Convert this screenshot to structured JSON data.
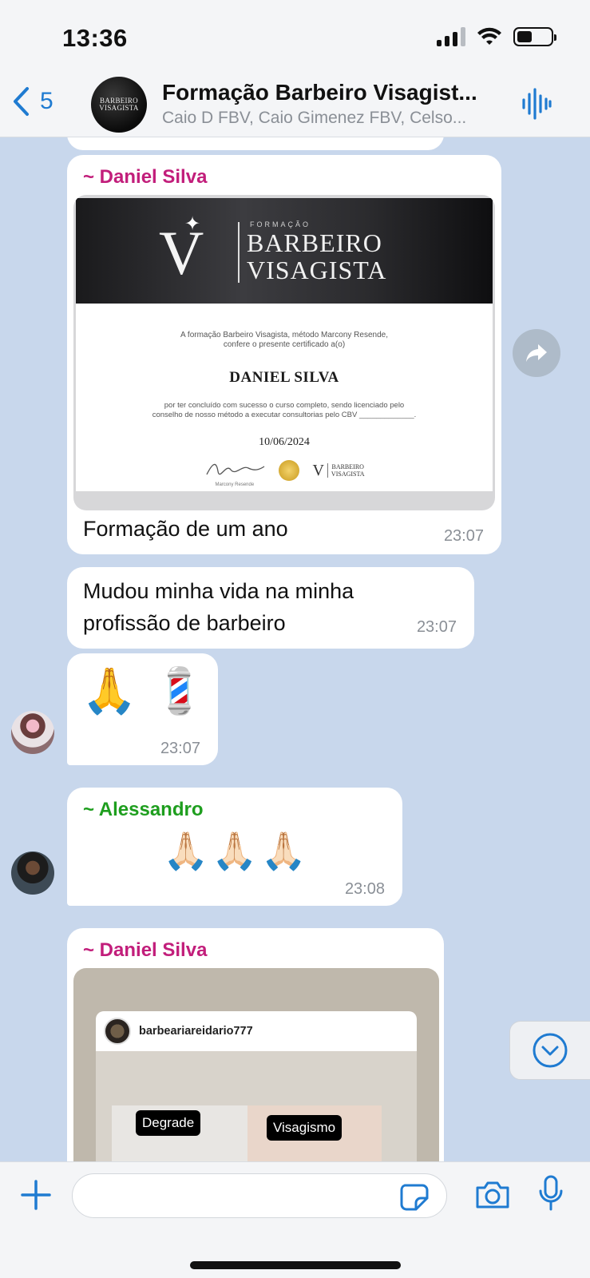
{
  "status_bar": {
    "time": "13:36"
  },
  "header": {
    "back_count": "5",
    "title": "Formação Barbeiro Visagist...",
    "subtitle": "Caio D FBV, Caio Gimenez FBV, Celso...",
    "avatar_text": [
      "BARBEIRO",
      "VISAGISTA"
    ]
  },
  "messages": [
    {
      "sender": "~ Daniel Silva",
      "sender_color": "#c21e7b",
      "certificate": {
        "small": "FORMAÇÃO",
        "big1": "BARBEIRO",
        "big2": "VISAGISTA",
        "intro1": "A formação Barbeiro Visagista, método Marcony Resende,",
        "intro2": "confere o presente certificado a(o)",
        "name": "DANIEL SILVA",
        "desc1": "por ter concluído com sucesso o curso completo, sendo licenciado pelo",
        "desc2": "conselho de nosso método a executar consultorias pelo CBV _____________.",
        "date": "10/06/2024",
        "signature_label": "Marcony Resende",
        "mini_logo_1": "BARBEIRO",
        "mini_logo_2": "VISAGISTA"
      },
      "text": "Formação de um ano",
      "time": "23:07"
    },
    {
      "text_line1": "Mudou minha vida na minha",
      "text_line2": "profissão de barbeiro",
      "time": "23:07"
    },
    {
      "emoji": "🙏 💈",
      "time": "23:07"
    },
    {
      "sender": "~ Alessandro",
      "sender_color": "#1e9e1e",
      "emoji": "🙏🏻🙏🏻🙏🏻",
      "time": "23:08"
    },
    {
      "sender": "~ Daniel Silva",
      "sender_color": "#c21e7b",
      "post": {
        "username": "barbeariareidario777",
        "tag1": "Degrade",
        "tag2": "Visagismo"
      }
    }
  ],
  "icons": {
    "back": "chevron-left-icon",
    "voice": "audio-waveform-icon",
    "forward": "forward-arrow-icon",
    "scroll_down": "chevron-down-circle-icon",
    "plus": "plus-icon",
    "sticker": "sticker-icon",
    "camera": "camera-icon",
    "mic": "microphone-icon"
  },
  "colors": {
    "accent": "#1f7bd1",
    "chat_bg": "#c8d7ec"
  }
}
